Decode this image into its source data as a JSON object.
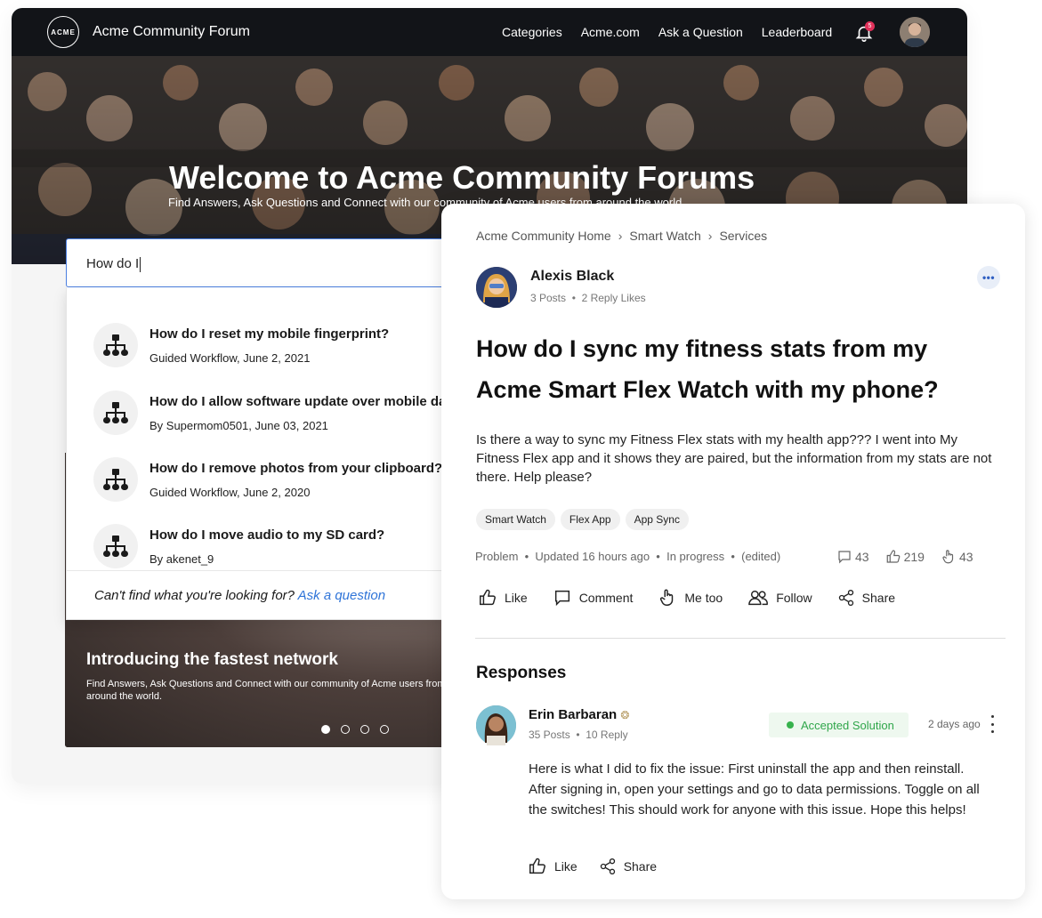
{
  "header": {
    "logo_text": "ACME",
    "site_title": "Acme Community Forum",
    "nav": [
      "Categories",
      "Acme.com",
      "Ask a Question",
      "Leaderboard"
    ],
    "notification_count": "5"
  },
  "hero": {
    "title": "Welcome to Acme Community Forums",
    "subtitle": "Find Answers, Ask Questions and Connect with our community of Acme users from around the world."
  },
  "search": {
    "value": "How do I"
  },
  "suggestions": [
    {
      "title": "How do I reset my mobile fingerprint?",
      "sub": "Guided Workflow, June 2, 2021"
    },
    {
      "title": "How do I allow software update over mobile data?",
      "sub": "By Supermom0501, June 03, 2021"
    },
    {
      "title": "How do I remove photos from your clipboard?",
      "sub": "Guided Workflow, June 2, 2020"
    },
    {
      "title": "How do I move audio to my SD card?",
      "sub": "By akenet_9"
    }
  ],
  "dropdown_footer": {
    "text": "Can't find what you're looking for?",
    "link": "Ask a question"
  },
  "carousel": {
    "title": "Introducing the fastest network",
    "subtitle": "Find Answers, Ask Questions and Connect with our community of Acme users from around the world.",
    "slides": 4,
    "active_slide": 1
  },
  "post": {
    "breadcrumbs": [
      "Acme Community Home",
      "Smart Watch",
      "Services"
    ],
    "author": {
      "name": "Alexis Black",
      "posts": "3 Posts",
      "likes": "2 Reply Likes"
    },
    "title": "How do I sync my fitness stats from my Acme Smart Flex Watch with my phone?",
    "body": "Is there a way to sync my Fitness Flex stats with my health app??? I went into My Fitness Flex app and it shows they are paired, but the information from my stats are not there. Help please?",
    "tags": [
      "Smart Watch",
      "Flex App",
      "App Sync"
    ],
    "meta": [
      "Problem",
      "Updated 16 hours ago",
      "In progress",
      "(edited)"
    ],
    "stats": {
      "comments": "43",
      "likes": "219",
      "me_too": "43"
    },
    "actions": {
      "like": "Like",
      "comment": "Comment",
      "me_too": "Me too",
      "follow": "Follow",
      "share": "Share"
    }
  },
  "responses": {
    "heading": "Responses",
    "items": [
      {
        "name": "Erin Barbaran",
        "posts": "35 Posts",
        "replies": "10 Reply",
        "badge": "Accepted Solution",
        "time": "2 days ago",
        "body": "Here is what I did to fix the issue: First uninstall the app and then reinstall. After signing in, open your settings and go to data permissions.  Toggle on all the switches! This should work for anyone with this issue. Hope this helps!",
        "like": "Like",
        "share": "Share"
      }
    ]
  },
  "colors": {
    "topbar": "#121418",
    "link": "#2f74d8",
    "accepted": "#2fa64a",
    "badge": "#e0315a"
  }
}
